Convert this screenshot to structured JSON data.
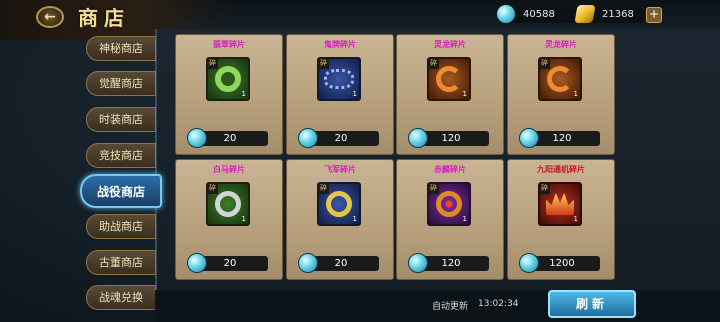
{
  "header": {
    "back_icon": "back-arrow-icon",
    "title": "商店",
    "currency_gem": "40588",
    "currency_gold": "21368",
    "plus_label": "+"
  },
  "tabs": [
    {
      "label": "神秘商店",
      "active": false
    },
    {
      "label": "觉醒商店",
      "active": false
    },
    {
      "label": "时装商店",
      "active": false
    },
    {
      "label": "竞技商店",
      "active": false
    },
    {
      "label": "战役商店",
      "active": true
    },
    {
      "label": "助战商店",
      "active": false
    },
    {
      "label": "古董商店",
      "active": false
    },
    {
      "label": "战魂兑换",
      "active": false
    }
  ],
  "items": [
    {
      "name": "翡翠碎片",
      "name_color": "#d61fbd",
      "rarity": "green",
      "icon": "jade-pendant-icon",
      "count": "1",
      "price": "20"
    },
    {
      "name": "鬼牌碎片",
      "name_color": "#d61fbd",
      "rarity": "blue",
      "icon": "chain-necklace-icon",
      "count": "1",
      "price": "20"
    },
    {
      "name": "灵龙碎片",
      "name_color": "#d61fbd",
      "rarity": "orange",
      "icon": "dragon-amulet-icon",
      "count": "1",
      "price": "120"
    },
    {
      "name": "灵龙碎片",
      "name_color": "#d61fbd",
      "rarity": "orange",
      "icon": "dragon-amulet-icon",
      "count": "1",
      "price": "120"
    },
    {
      "name": "白马碎片",
      "name_color": "#d61fbd",
      "rarity": "green",
      "icon": "silver-ring-icon",
      "count": "1",
      "price": "20"
    },
    {
      "name": "飞军碎片",
      "name_color": "#d61fbd",
      "rarity": "blue",
      "icon": "gold-ring-icon",
      "count": "1",
      "price": "20"
    },
    {
      "name": "赤麟碎片",
      "name_color": "#d61fbd",
      "rarity": "purple",
      "icon": "ruby-ring-icon",
      "count": "1",
      "price": "120"
    },
    {
      "name": "九阳通机碎片",
      "name_color": "#c4161c",
      "rarity": "red",
      "icon": "crown-icon",
      "count": "1",
      "price": "1200"
    }
  ],
  "frag_badge": "碎",
  "footer": {
    "refresh_label": "自动更新",
    "refresh_time": "13:02:34",
    "refresh_button": "刷新"
  }
}
